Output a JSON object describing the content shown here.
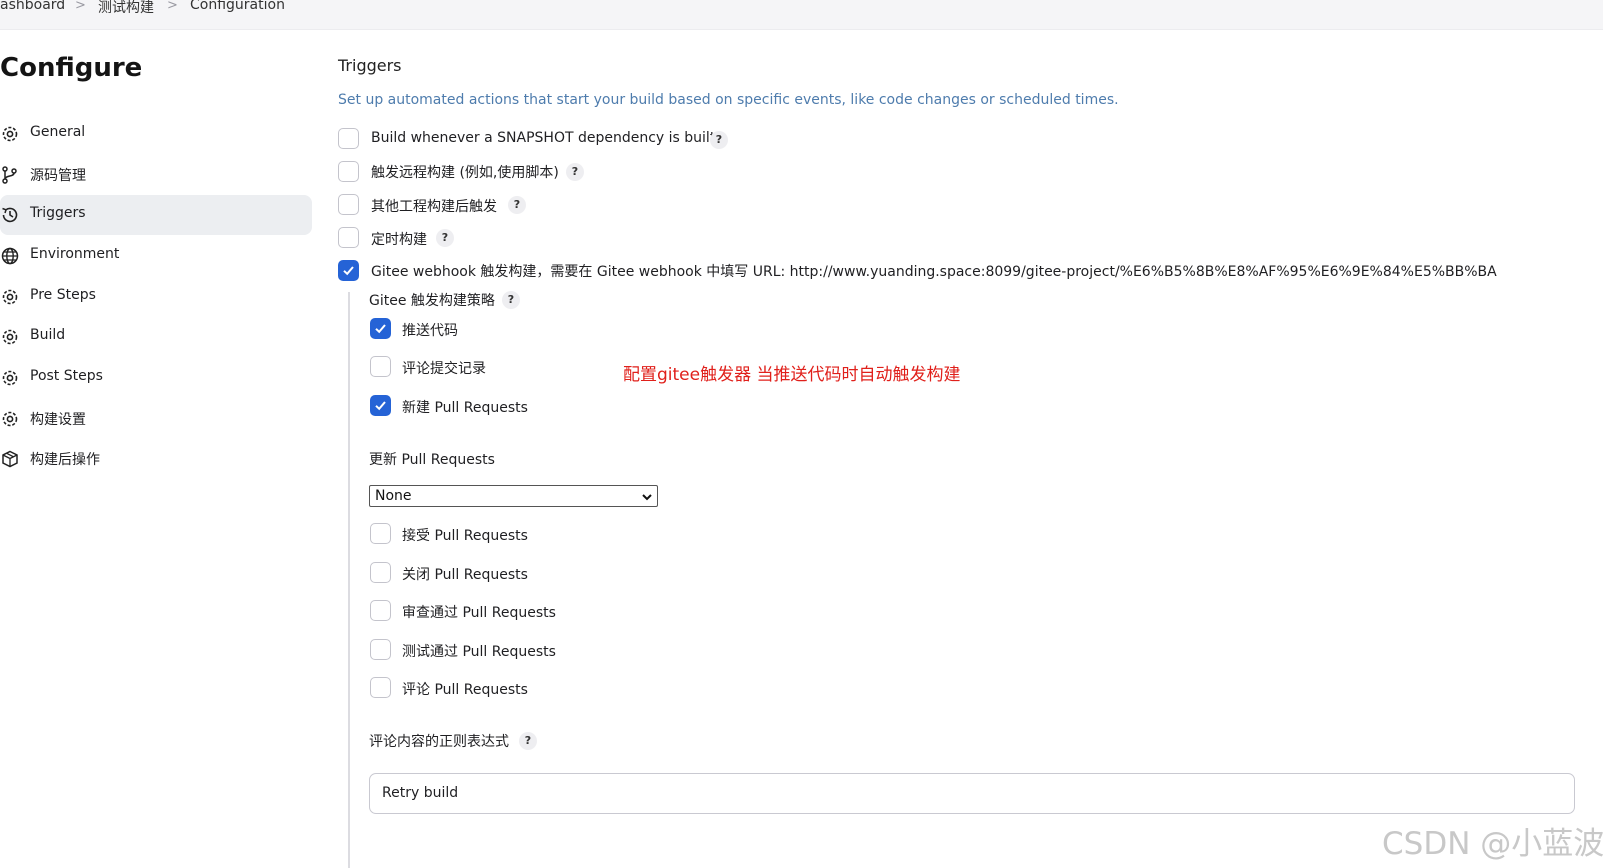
{
  "breadcrumb": {
    "items": [
      "ashboard",
      "测试构建",
      "Configuration"
    ],
    "separator": ">"
  },
  "page_title": "Configure",
  "sidebar": {
    "items": [
      {
        "label": "General",
        "icon": "gear-icon"
      },
      {
        "label": "源码管理",
        "icon": "branch-icon"
      },
      {
        "label": "Triggers",
        "icon": "clock-icon",
        "active": true
      },
      {
        "label": "Environment",
        "icon": "globe-icon"
      },
      {
        "label": "Pre Steps",
        "icon": "gear-icon"
      },
      {
        "label": "Build",
        "icon": "gear-icon"
      },
      {
        "label": "Post Steps",
        "icon": "gear-icon"
      },
      {
        "label": "构建设置",
        "icon": "gear-icon"
      },
      {
        "label": "构建后操作",
        "icon": "cube-icon"
      }
    ]
  },
  "triggers": {
    "title": "Triggers",
    "description": "Set up automated actions that start your build based on specific events, like code changes or scheduled times.",
    "options": [
      {
        "label": "Build whenever a SNAPSHOT dependency is built",
        "checked": false,
        "help": "?"
      },
      {
        "label": "触发远程构建 (例如,使用脚本)",
        "checked": false,
        "help": "?"
      },
      {
        "label": "其他工程构建后触发",
        "checked": false,
        "help": "?"
      },
      {
        "label": "定时构建",
        "checked": false,
        "help": "?"
      },
      {
        "label": "Gitee webhook 触发构建，需要在 Gitee webhook 中填写 URL: http://www.yuanding.space:8099/gitee-project/%E6%B5%8B%E8%AF%95%E6%9E%84%E5%BB%BA",
        "checked": true
      }
    ]
  },
  "gitee": {
    "strategy_label": "Gitee 触发构建策略",
    "strategy_help": "?",
    "strategy_options": [
      {
        "label": "推送代码",
        "checked": true
      },
      {
        "label": "评论提交记录",
        "checked": false
      },
      {
        "label": "新建 Pull Requests",
        "checked": true
      }
    ],
    "update_pr_label": "更新 Pull Requests",
    "update_pr_value": "None",
    "pr_options": [
      {
        "label": "接受 Pull Requests",
        "checked": false
      },
      {
        "label": "关闭 Pull Requests",
        "checked": false
      },
      {
        "label": "审查通过 Pull Requests",
        "checked": false
      },
      {
        "label": "测试通过 Pull Requests",
        "checked": false
      },
      {
        "label": "评论 Pull Requests",
        "checked": false
      }
    ],
    "comment_regex_label": "评论内容的正则表达式",
    "comment_regex_help": "?",
    "comment_regex_value": "Retry build"
  },
  "annotation": "配置gitee触发器 当推送代码时自动触发构建",
  "watermark": "CSDN @小蓝波",
  "colors": {
    "accent": "#2563d6",
    "description": "#4e7cad",
    "annotation": "#e0201b"
  }
}
